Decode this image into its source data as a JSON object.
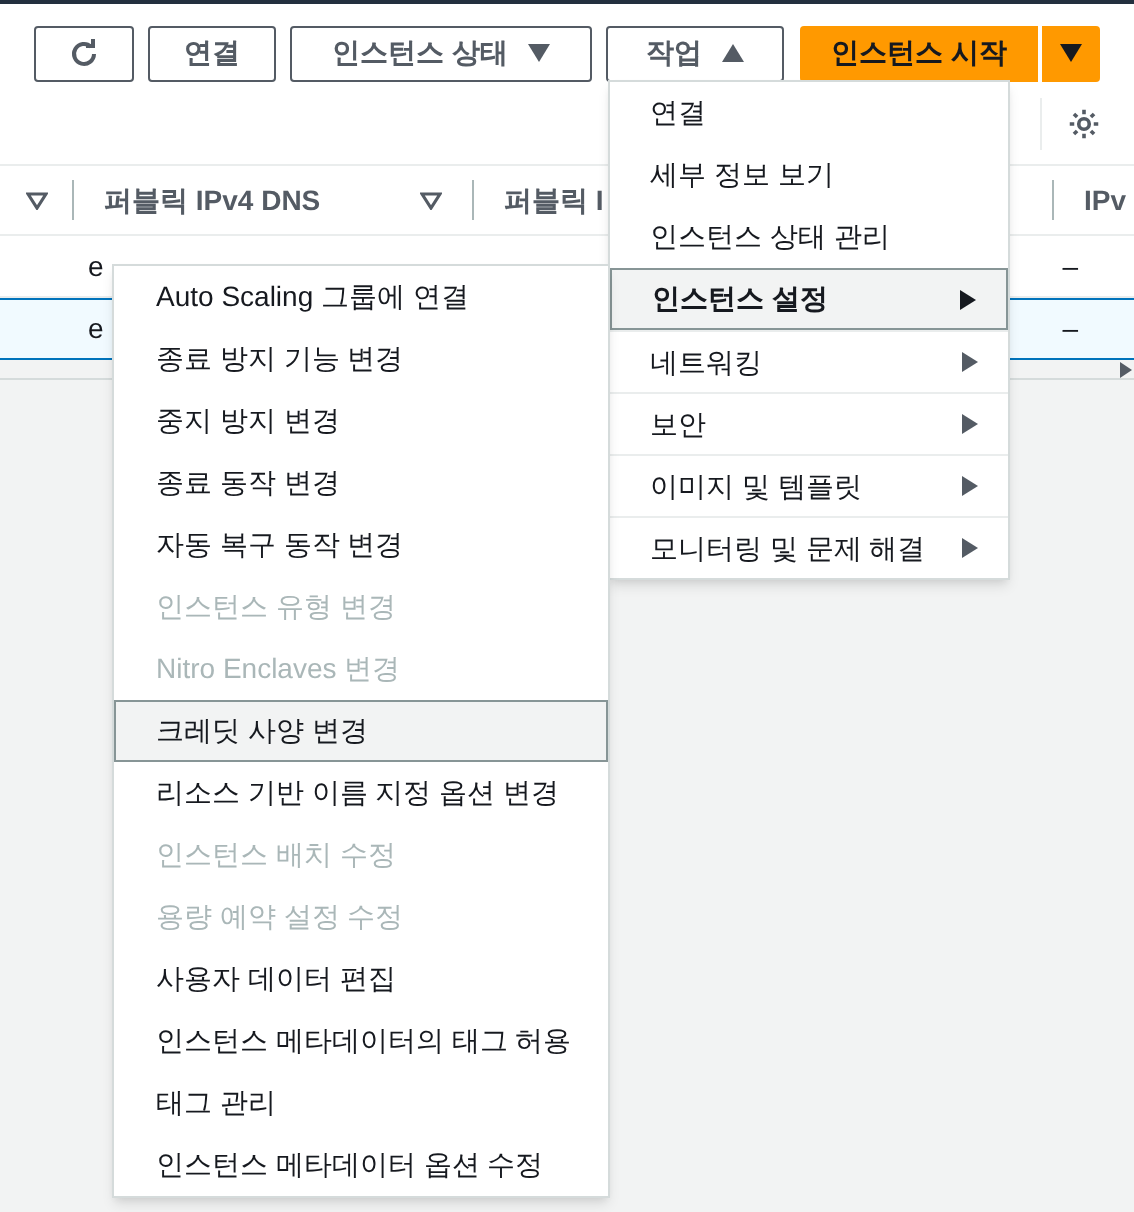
{
  "toolbar": {
    "buttons": [
      {
        "kind": "refresh"
      },
      {
        "kind": "text",
        "label": "연결"
      },
      {
        "kind": "dropdown",
        "label": "인스턴스 상태",
        "expanded": false
      },
      {
        "kind": "dropdown",
        "label": "작업",
        "expanded": true
      }
    ],
    "primary": {
      "label": "인스턴스 시작"
    }
  },
  "table": {
    "columns": [
      {
        "label": "퍼블릭 IPv4 DNS"
      },
      {
        "label": "퍼블릭 I"
      },
      {
        "label": "IPv"
      }
    ],
    "rows": [
      {
        "selected": false,
        "cells": [
          "e",
          "–"
        ]
      },
      {
        "selected": true,
        "cells": [
          "e",
          "–"
        ]
      }
    ]
  },
  "actions_menu": {
    "items": [
      {
        "kind": "item",
        "label": "연결",
        "selected": false
      },
      {
        "kind": "item",
        "label": "세부 정보 보기",
        "selected": false
      },
      {
        "kind": "item",
        "label": "인스턴스 상태 관리",
        "selected": false
      },
      {
        "kind": "submenu",
        "label": "인스턴스 설정",
        "selected": true
      },
      {
        "kind": "submenu",
        "label": "네트워킹",
        "selected": false
      },
      {
        "kind": "submenu",
        "label": "보안",
        "selected": false
      },
      {
        "kind": "submenu",
        "label": "이미지 및 템플릿",
        "selected": false
      },
      {
        "kind": "submenu",
        "label": "모니터링 및 문제 해결",
        "selected": false
      }
    ]
  },
  "settings_submenu": {
    "items": [
      {
        "label": "Auto Scaling 그룹에 연결",
        "disabled": false,
        "selected": false
      },
      {
        "label": "종료 방지 기능 변경",
        "disabled": false,
        "selected": false
      },
      {
        "label": "중지 방지 변경",
        "disabled": false,
        "selected": false
      },
      {
        "label": "종료 동작 변경",
        "disabled": false,
        "selected": false
      },
      {
        "label": "자동 복구 동작 변경",
        "disabled": false,
        "selected": false
      },
      {
        "label": "인스턴스 유형 변경",
        "disabled": true,
        "selected": false
      },
      {
        "label": "Nitro Enclaves 변경",
        "disabled": true,
        "selected": false
      },
      {
        "label": "크레딧 사양 변경",
        "disabled": false,
        "selected": true
      },
      {
        "label": "리소스 기반 이름 지정 옵션 변경",
        "disabled": false,
        "selected": false
      },
      {
        "label": "인스턴스 배치 수정",
        "disabled": true,
        "selected": false
      },
      {
        "label": "용량 예약 설정 수정",
        "disabled": true,
        "selected": false
      },
      {
        "label": "사용자 데이터 편집",
        "disabled": false,
        "selected": false
      },
      {
        "label": "인스턴스 메타데이터의 태그 허용",
        "disabled": false,
        "selected": false
      },
      {
        "label": "태그 관리",
        "disabled": false,
        "selected": false
      },
      {
        "label": "인스턴스 메타데이터 옵션 수정",
        "disabled": false,
        "selected": false
      }
    ]
  }
}
